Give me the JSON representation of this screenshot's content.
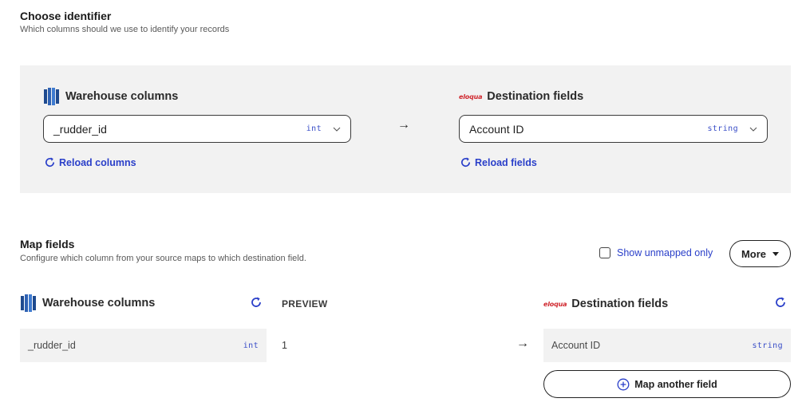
{
  "identifier": {
    "title": "Choose identifier",
    "subtitle": "Which columns should we use to identify your records",
    "warehouse": {
      "heading": "Warehouse columns",
      "selected_value": "_rudder_id",
      "selected_type": "int",
      "reload_label": "Reload columns"
    },
    "destination": {
      "heading": "Destination fields",
      "logo_text": "eloqua",
      "selected_value": "Account ID",
      "selected_type": "string",
      "reload_label": "Reload fields"
    },
    "arrow": "→"
  },
  "map_fields": {
    "title": "Map fields",
    "subtitle": "Configure which column from your source maps to which destination field.",
    "show_unmapped_label": "Show unmapped only",
    "more_label": "More",
    "warehouse_heading": "Warehouse columns",
    "preview_heading": "PREVIEW",
    "destination_heading": "Destination fields",
    "destination_logo_text": "eloqua",
    "rows": [
      {
        "source": "_rudder_id",
        "source_type": "int",
        "preview": "1",
        "arrow": "→",
        "destination": "Account ID",
        "destination_type": "string"
      }
    ],
    "map_another_label": "Map another field"
  },
  "colors": {
    "accent": "#2a3fc9",
    "panel_bg": "#f2f2f2",
    "eloqua_red": "#d0282f",
    "warehouse_blue": "#2f62b3"
  },
  "icons": {
    "warehouse": "database-columns-icon",
    "reload": "reload-icon",
    "chevron": "chevron-down-icon",
    "plus": "plus-circle-icon",
    "caret": "caret-down-icon"
  }
}
